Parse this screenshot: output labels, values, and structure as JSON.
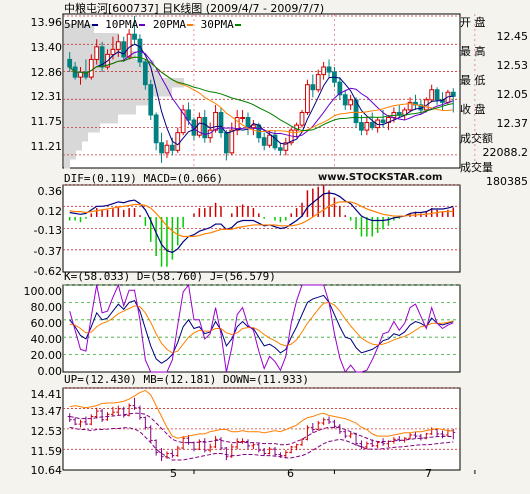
{
  "header": {
    "title": "中粮屯河[600737] 日K线图 (2009/4/7 - 2009/7/7)"
  },
  "side_panel": {
    "open_label": "开 盘",
    "open_value": "12.45",
    "high_label": "最 高",
    "high_value": "12.53",
    "low_label": "最 低",
    "low_value": "12.05",
    "close_label": "收 盘",
    "close_value": "12.37",
    "amount_label": "成交额",
    "amount_value": "22088.2",
    "volume_label": "成交量",
    "volume_value": "180385"
  },
  "watermark": "www.STOCKSTAR.com",
  "colors": {
    "up": "#d40000",
    "down": "#00a000",
    "ma5": "#000080",
    "ma10": "#6600cc",
    "ma20": "#ff8000",
    "ma30": "#008000",
    "grid": "#cc3333",
    "volume_profile": "#d8d8d8",
    "macd_pos": "#cc0000",
    "macd_neg": "#00cc00",
    "panel_bg": "#ffffff",
    "boll_mid": "#800080"
  },
  "chart_data": [
    {
      "type": "candlestick",
      "panel": "price",
      "legend": [
        {
          "label": "5PMA",
          "color": "#000080"
        },
        {
          "label": "10PMA",
          "color": "#6600cc"
        },
        {
          "label": "20PMA",
          "color": "#ff8000"
        },
        {
          "label": "30PMA",
          "color": "#008000"
        }
      ],
      "y_ticks": [
        "13.96",
        "13.40",
        "12.86",
        "12.31",
        "11.75",
        "11.21"
      ],
      "ylim": [
        10.95,
        14.0
      ],
      "x_ticks": [
        "5",
        "6",
        "7"
      ],
      "x_tick_index": [
        23,
        49,
        75
      ],
      "volume_profile": [
        0.25,
        0.45,
        0.55,
        0.6,
        0.75,
        0.8,
        1.0,
        0.9,
        0.7,
        0.6,
        0.45,
        0.3,
        0.2,
        0.15,
        0.1,
        0.05
      ],
      "candles": [
        {
          "o": 13.1,
          "h": 13.25,
          "l": 12.85,
          "c": 12.95
        },
        {
          "o": 12.95,
          "h": 13.05,
          "l": 12.7,
          "c": 12.75
        },
        {
          "o": 12.75,
          "h": 12.95,
          "l": 12.6,
          "c": 12.85
        },
        {
          "o": 12.85,
          "h": 13.1,
          "l": 12.7,
          "c": 12.75
        },
        {
          "o": 12.75,
          "h": 13.2,
          "l": 12.7,
          "c": 13.1
        },
        {
          "o": 13.1,
          "h": 13.5,
          "l": 13.0,
          "c": 13.35
        },
        {
          "o": 13.35,
          "h": 13.45,
          "l": 12.85,
          "c": 12.95
        },
        {
          "o": 12.95,
          "h": 13.3,
          "l": 12.9,
          "c": 13.2
        },
        {
          "o": 13.2,
          "h": 13.55,
          "l": 13.1,
          "c": 13.3
        },
        {
          "o": 13.3,
          "h": 13.6,
          "l": 13.15,
          "c": 13.45
        },
        {
          "o": 13.45,
          "h": 13.55,
          "l": 13.05,
          "c": 13.15
        },
        {
          "o": 13.15,
          "h": 13.7,
          "l": 13.1,
          "c": 13.6
        },
        {
          "o": 13.6,
          "h": 13.96,
          "l": 13.4,
          "c": 13.5
        },
        {
          "o": 13.5,
          "h": 13.6,
          "l": 12.95,
          "c": 13.05
        },
        {
          "o": 13.05,
          "h": 13.1,
          "l": 12.5,
          "c": 12.6
        },
        {
          "o": 12.6,
          "h": 12.7,
          "l": 11.9,
          "c": 12.0
        },
        {
          "o": 12.0,
          "h": 12.05,
          "l": 11.3,
          "c": 11.45
        },
        {
          "o": 11.45,
          "h": 11.65,
          "l": 11.05,
          "c": 11.25
        },
        {
          "o": 11.25,
          "h": 11.5,
          "l": 11.15,
          "c": 11.4
        },
        {
          "o": 11.4,
          "h": 11.55,
          "l": 11.2,
          "c": 11.3
        },
        {
          "o": 11.3,
          "h": 11.75,
          "l": 11.25,
          "c": 11.65
        },
        {
          "o": 11.65,
          "h": 12.2,
          "l": 11.6,
          "c": 12.1
        },
        {
          "o": 12.1,
          "h": 12.25,
          "l": 11.8,
          "c": 11.9
        },
        {
          "o": 11.9,
          "h": 11.95,
          "l": 11.5,
          "c": 11.6
        },
        {
          "o": 11.6,
          "h": 12.05,
          "l": 11.55,
          "c": 11.95
        },
        {
          "o": 11.95,
          "h": 12.1,
          "l": 11.45,
          "c": 11.55
        },
        {
          "o": 11.55,
          "h": 11.85,
          "l": 11.45,
          "c": 11.7
        },
        {
          "o": 11.7,
          "h": 12.2,
          "l": 11.65,
          "c": 12.05
        },
        {
          "o": 12.05,
          "h": 12.15,
          "l": 11.55,
          "c": 11.65
        },
        {
          "o": 11.65,
          "h": 11.7,
          "l": 11.1,
          "c": 11.25
        },
        {
          "o": 11.25,
          "h": 11.85,
          "l": 11.2,
          "c": 11.7
        },
        {
          "o": 11.7,
          "h": 12.1,
          "l": 11.6,
          "c": 11.95
        },
        {
          "o": 11.95,
          "h": 12.1,
          "l": 11.85,
          "c": 11.95
        },
        {
          "o": 11.95,
          "h": 12.05,
          "l": 11.6,
          "c": 11.75
        },
        {
          "o": 11.75,
          "h": 11.9,
          "l": 11.6,
          "c": 11.8
        },
        {
          "o": 11.8,
          "h": 11.85,
          "l": 11.45,
          "c": 11.55
        },
        {
          "o": 11.55,
          "h": 11.65,
          "l": 11.3,
          "c": 11.4
        },
        {
          "o": 11.4,
          "h": 11.7,
          "l": 11.35,
          "c": 11.6
        },
        {
          "o": 11.6,
          "h": 11.7,
          "l": 11.3,
          "c": 11.35
        },
        {
          "o": 11.35,
          "h": 11.45,
          "l": 11.2,
          "c": 11.3
        },
        {
          "o": 11.3,
          "h": 11.55,
          "l": 11.2,
          "c": 11.45
        },
        {
          "o": 11.45,
          "h": 11.75,
          "l": 11.4,
          "c": 11.7
        },
        {
          "o": 11.7,
          "h": 11.85,
          "l": 11.55,
          "c": 11.8
        },
        {
          "o": 11.8,
          "h": 12.1,
          "l": 11.75,
          "c": 12.05
        },
        {
          "o": 12.05,
          "h": 12.7,
          "l": 12.0,
          "c": 12.6
        },
        {
          "o": 12.6,
          "h": 12.8,
          "l": 12.35,
          "c": 12.5
        },
        {
          "o": 12.5,
          "h": 12.9,
          "l": 12.45,
          "c": 12.8
        },
        {
          "o": 12.8,
          "h": 13.05,
          "l": 12.7,
          "c": 12.95
        },
        {
          "o": 12.95,
          "h": 13.1,
          "l": 12.75,
          "c": 12.85
        },
        {
          "o": 12.85,
          "h": 12.95,
          "l": 12.55,
          "c": 12.65
        },
        {
          "o": 12.65,
          "h": 12.75,
          "l": 12.3,
          "c": 12.4
        },
        {
          "o": 12.4,
          "h": 12.5,
          "l": 12.1,
          "c": 12.2
        },
        {
          "o": 12.2,
          "h": 12.4,
          "l": 12.1,
          "c": 12.3
        },
        {
          "o": 12.3,
          "h": 12.35,
          "l": 11.75,
          "c": 11.85
        },
        {
          "o": 11.85,
          "h": 12.0,
          "l": 11.6,
          "c": 11.7
        },
        {
          "o": 11.7,
          "h": 11.95,
          "l": 11.6,
          "c": 11.85
        },
        {
          "o": 11.85,
          "h": 12.05,
          "l": 11.7,
          "c": 11.75
        },
        {
          "o": 11.75,
          "h": 11.95,
          "l": 11.65,
          "c": 11.9
        },
        {
          "o": 11.9,
          "h": 12.1,
          "l": 11.75,
          "c": 11.85
        },
        {
          "o": 11.85,
          "h": 12.0,
          "l": 11.7,
          "c": 11.95
        },
        {
          "o": 11.95,
          "h": 12.15,
          "l": 11.85,
          "c": 12.05
        },
        {
          "o": 12.05,
          "h": 12.2,
          "l": 11.95,
          "c": 12.0
        },
        {
          "o": 12.0,
          "h": 12.15,
          "l": 11.9,
          "c": 12.1
        },
        {
          "o": 12.1,
          "h": 12.35,
          "l": 12.05,
          "c": 12.25
        },
        {
          "o": 12.25,
          "h": 12.4,
          "l": 12.1,
          "c": 12.2
        },
        {
          "o": 12.2,
          "h": 12.3,
          "l": 12.0,
          "c": 12.1
        },
        {
          "o": 12.1,
          "h": 12.35,
          "l": 12.05,
          "c": 12.3
        },
        {
          "o": 12.3,
          "h": 12.6,
          "l": 12.25,
          "c": 12.5
        },
        {
          "o": 12.5,
          "h": 12.55,
          "l": 12.2,
          "c": 12.3
        },
        {
          "o": 12.3,
          "h": 12.45,
          "l": 12.1,
          "c": 12.25
        },
        {
          "o": 12.25,
          "h": 12.5,
          "l": 12.2,
          "c": 12.45
        },
        {
          "o": 12.45,
          "h": 12.53,
          "l": 12.05,
          "c": 12.37
        }
      ]
    },
    {
      "type": "bar",
      "panel": "macd",
      "legend_text": "DIF=(0.119)  MACD=(0.066)",
      "y_ticks": [
        "0.36",
        "0.12",
        "-0.13",
        "-0.37",
        "-0.62"
      ],
      "ylim": [
        -0.62,
        0.36
      ],
      "dif": [
        0.05,
        0.04,
        0.03,
        0.04,
        0.08,
        0.12,
        0.12,
        0.13,
        0.15,
        0.17,
        0.16,
        0.18,
        0.19,
        0.15,
        0.08,
        -0.04,
        -0.18,
        -0.31,
        -0.38,
        -0.4,
        -0.36,
        -0.28,
        -0.22,
        -0.2,
        -0.16,
        -0.14,
        -0.12,
        -0.08,
        -0.08,
        -0.14,
        -0.12,
        -0.06,
        -0.04,
        -0.04,
        -0.04,
        -0.07,
        -0.1,
        -0.09,
        -0.11,
        -0.13,
        -0.12,
        -0.08,
        -0.04,
        0.01,
        0.11,
        0.16,
        0.21,
        0.26,
        0.27,
        0.26,
        0.23,
        0.18,
        0.15,
        0.08,
        0.01,
        -0.02,
        -0.04,
        -0.04,
        -0.04,
        -0.03,
        -0.01,
        0.0,
        0.01,
        0.04,
        0.05,
        0.05,
        0.06,
        0.09,
        0.09,
        0.09,
        0.1,
        0.119
      ],
      "dea": [
        0.07,
        0.06,
        0.06,
        0.05,
        0.06,
        0.07,
        0.08,
        0.09,
        0.1,
        0.11,
        0.12,
        0.13,
        0.14,
        0.14,
        0.13,
        0.1,
        0.04,
        -0.03,
        -0.1,
        -0.16,
        -0.2,
        -0.22,
        -0.22,
        -0.22,
        -0.21,
        -0.19,
        -0.18,
        -0.16,
        -0.14,
        -0.14,
        -0.14,
        -0.12,
        -0.11,
        -0.1,
        -0.09,
        -0.09,
        -0.09,
        -0.09,
        -0.09,
        -0.1,
        -0.1,
        -0.1,
        -0.09,
        -0.07,
        -0.04,
        0.0,
        0.04,
        0.08,
        0.12,
        0.15,
        0.17,
        0.17,
        0.17,
        0.15,
        0.12,
        0.09,
        0.07,
        0.05,
        0.03,
        0.02,
        0.01,
        0.01,
        0.01,
        0.02,
        0.02,
        0.03,
        0.03,
        0.04,
        0.05,
        0.06,
        0.06,
        0.066
      ]
    },
    {
      "type": "line",
      "panel": "kdj",
      "legend_text": "K=(58.033)  D=(58.760)  J=(56.579)",
      "y_ticks": [
        "100.00",
        "80.00",
        "60.00",
        "40.00",
        "20.00",
        "0.00"
      ],
      "ylim": [
        0,
        100
      ],
      "k": [
        60,
        52,
        42,
        38,
        52,
        68,
        60,
        62,
        70,
        78,
        72,
        80,
        82,
        70,
        50,
        30,
        15,
        10,
        14,
        20,
        34,
        52,
        60,
        50,
        52,
        44,
        46,
        58,
        48,
        30,
        38,
        52,
        58,
        52,
        50,
        40,
        30,
        32,
        28,
        22,
        26,
        40,
        52,
        66,
        80,
        84,
        86,
        88,
        80,
        66,
        52,
        40,
        38,
        28,
        22,
        24,
        26,
        30,
        36,
        38,
        44,
        42,
        46,
        54,
        58,
        56,
        52,
        62,
        56,
        54,
        56,
        58
      ],
      "d": [
        55,
        54,
        50,
        45,
        46,
        52,
        56,
        58,
        62,
        67,
        70,
        73,
        76,
        75,
        68,
        57,
        44,
        33,
        26,
        22,
        24,
        32,
        40,
        45,
        48,
        47,
        47,
        50,
        50,
        45,
        43,
        45,
        50,
        51,
        51,
        48,
        43,
        39,
        36,
        32,
        30,
        32,
        37,
        46,
        56,
        64,
        72,
        79,
        80,
        77,
        70,
        61,
        53,
        46,
        39,
        35,
        32,
        31,
        32,
        34,
        37,
        39,
        41,
        44,
        48,
        52,
        53,
        56,
        56,
        56,
        57,
        58.76
      ],
      "j": [
        70,
        48,
        26,
        24,
        64,
        100,
        68,
        70,
        86,
        100,
        76,
        94,
        94,
        60,
        14,
        0,
        0,
        0,
        0,
        14,
        54,
        92,
        100,
        60,
        60,
        38,
        44,
        74,
        44,
        0,
        28,
        66,
        74,
        54,
        48,
        24,
        4,
        18,
        12,
        2,
        18,
        56,
        82,
        100,
        100,
        100,
        100,
        100,
        80,
        44,
        16,
        0,
        8,
        0,
        0,
        2,
        14,
        28,
        44,
        46,
        58,
        48,
        56,
        74,
        78,
        64,
        50,
        74,
        56,
        50,
        54,
        56.579
      ]
    },
    {
      "type": "bollinger",
      "panel": "boll",
      "legend_text": "UP=(12.430)  MB=(12.181)  DOWN=(11.933)",
      "y_ticks": [
        "14.41",
        "13.47",
        "12.53",
        "11.59",
        "10.64"
      ],
      "ylim": [
        10.64,
        14.41
      ],
      "up": [
        13.55,
        13.6,
        13.55,
        13.5,
        13.55,
        13.6,
        13.7,
        13.72,
        13.72,
        13.75,
        13.8,
        13.9,
        14.05,
        14.2,
        14.3,
        14.1,
        13.6,
        13.1,
        12.6,
        12.2,
        12.1,
        12.15,
        12.2,
        12.25,
        12.3,
        12.3,
        12.4,
        12.45,
        12.5,
        12.5,
        12.4,
        12.4,
        12.45,
        12.4,
        12.4,
        12.4,
        12.35,
        12.4,
        12.45,
        12.4,
        12.5,
        12.6,
        12.7,
        12.9,
        13.05,
        13.1,
        13.2,
        13.25,
        13.15,
        13.1,
        13.05,
        13.0,
        12.9,
        12.8,
        12.6,
        12.5,
        12.3,
        12.2,
        12.2,
        12.2,
        12.25,
        12.3,
        12.35,
        12.35,
        12.4,
        12.4,
        12.45,
        12.5,
        12.55,
        12.5,
        12.45,
        12.43
      ],
      "mb": [
        13.1,
        13.05,
        13.0,
        13.0,
        13.0,
        13.05,
        13.08,
        13.1,
        13.12,
        13.15,
        13.18,
        13.22,
        13.25,
        13.25,
        13.2,
        13.05,
        12.8,
        12.55,
        12.3,
        12.05,
        11.95,
        11.9,
        11.9,
        11.9,
        11.92,
        11.92,
        11.95,
        12.0,
        12.0,
        11.95,
        11.9,
        11.9,
        11.92,
        11.9,
        11.9,
        11.88,
        11.85,
        11.85,
        11.85,
        11.8,
        11.8,
        11.85,
        11.95,
        12.05,
        12.2,
        12.35,
        12.45,
        12.55,
        12.6,
        12.6,
        12.58,
        12.5,
        12.4,
        12.3,
        12.2,
        12.1,
        12.0,
        11.95,
        11.95,
        11.95,
        11.98,
        12.0,
        12.02,
        12.05,
        12.08,
        12.1,
        12.12,
        12.15,
        12.18,
        12.18,
        12.18,
        12.181
      ],
      "down": [
        12.6,
        12.55,
        12.5,
        12.5,
        12.45,
        12.5,
        12.5,
        12.52,
        12.55,
        12.55,
        12.58,
        12.58,
        12.52,
        12.4,
        12.15,
        11.9,
        11.6,
        11.4,
        11.25,
        11.1,
        11.1,
        11.1,
        11.15,
        11.2,
        11.25,
        11.3,
        11.35,
        11.4,
        11.4,
        11.35,
        11.3,
        11.3,
        11.35,
        11.35,
        11.35,
        11.32,
        11.3,
        11.3,
        11.28,
        11.25,
        11.2,
        11.2,
        11.25,
        11.3,
        11.4,
        11.55,
        11.7,
        11.85,
        11.95,
        12.0,
        12.05,
        12.0,
        11.9,
        11.8,
        11.7,
        11.6,
        11.6,
        11.6,
        11.62,
        11.65,
        11.68,
        11.7,
        11.72,
        11.75,
        11.78,
        11.8,
        11.8,
        11.82,
        11.85,
        11.88,
        11.9,
        11.933
      ]
    }
  ]
}
